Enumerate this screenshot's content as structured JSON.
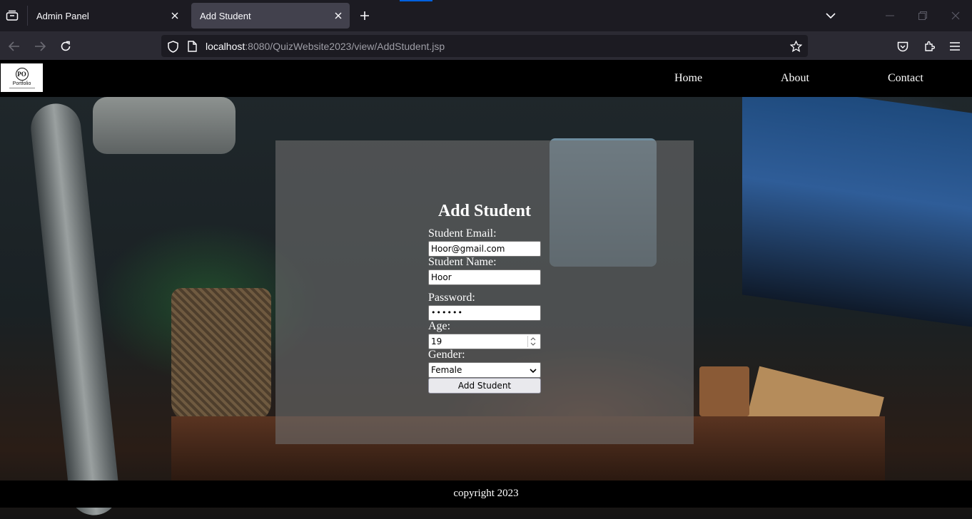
{
  "browser": {
    "tabs": [
      {
        "label": "Admin Panel"
      },
      {
        "label": "Add Student"
      }
    ],
    "url": {
      "host": "localhost",
      "rest": ":8080/QuizWebsite2023/view/AddStudent.jsp"
    }
  },
  "site": {
    "logo": {
      "monogram": "PO",
      "text": "Portfolio"
    },
    "nav": {
      "home": "Home",
      "about": "About",
      "contact": "Contact"
    },
    "footer": "copyright 2023"
  },
  "form": {
    "title": "Add Student",
    "email_label": "Student Email:",
    "email_value": "Hoor@gmail.com",
    "name_label": "Student Name:",
    "name_value": "Hoor",
    "password_label": "Password:",
    "password_value": "••••••",
    "age_label": "Age:",
    "age_value": "19",
    "gender_label": "Gender:",
    "gender_value": "Female",
    "submit_label": "Add Student"
  },
  "colors": {
    "chrome_bg": "#1c1b22",
    "toolbar_bg": "#2b2a33",
    "active_tab": "#42414d",
    "accent": "#0060df"
  },
  "icons": [
    "tab-list-icon",
    "close-icon",
    "plus-icon",
    "chevron-down-icon",
    "minimize-icon",
    "restore-icon",
    "back-arrow-icon",
    "forward-arrow-icon",
    "reload-icon",
    "shield-icon",
    "page-icon",
    "star-icon",
    "pocket-icon",
    "extensions-icon",
    "menu-icon"
  ]
}
